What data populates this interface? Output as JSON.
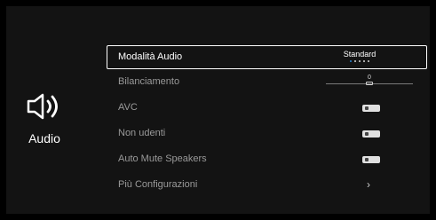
{
  "sidebar": {
    "icon": "speaker-icon",
    "label": "Audio"
  },
  "menu": {
    "items": [
      {
        "label": "Modalità Audio",
        "value": "Standard",
        "selected": true,
        "control": "selector",
        "position": 1,
        "count": 5
      },
      {
        "label": "Bilanciamento",
        "value": "0",
        "control": "slider",
        "level": 0.5
      },
      {
        "label": "AVC",
        "control": "toggle",
        "on": false
      },
      {
        "label": "Non udenti",
        "control": "toggle",
        "on": false
      },
      {
        "label": "Auto Mute Speakers",
        "control": "toggle",
        "on": false
      },
      {
        "label": "Più Configurazioni",
        "control": "submenu",
        "icon": "chevron-right-icon"
      }
    ]
  },
  "colors": {
    "background": "#000000",
    "panel": "#131313",
    "selection_border": "#ffffff",
    "accent": "#2a8ad8",
    "dim_text": "#9a9a9a"
  }
}
